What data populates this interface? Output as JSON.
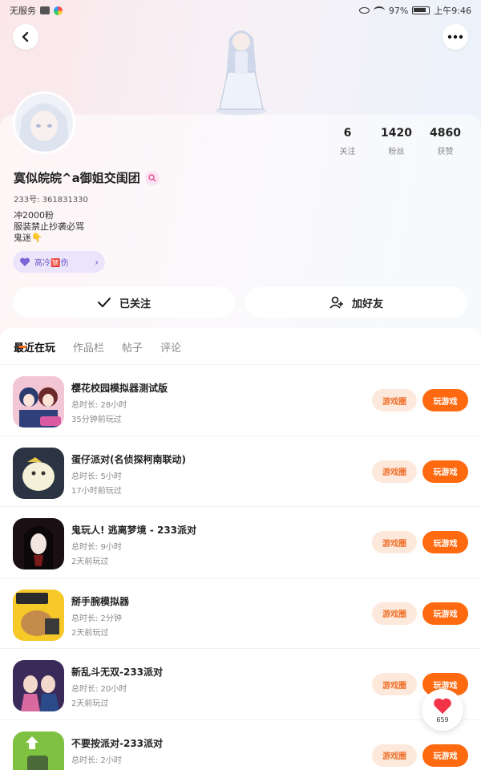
{
  "status_bar": {
    "left_text": "无服务",
    "battery": "97%",
    "time": "上午9:46"
  },
  "profile": {
    "name": "寞似皖皖^a御姐交闺团",
    "uid": "233号: 361831330",
    "bio": [
      "冲2000粉",
      "服装禁止抄袭必骂",
      "鬼迷👇"
    ],
    "tag_chip": "高冷🈲伤",
    "stats": [
      {
        "value": "6",
        "label": "关注"
      },
      {
        "value": "1420",
        "label": "粉丝"
      },
      {
        "value": "4860",
        "label": "获赞"
      }
    ],
    "follow_label": "已关注",
    "add_friend_label": "加好友"
  },
  "tabs": [
    {
      "label": "最近在玩",
      "active": true
    },
    {
      "label": "作品栏",
      "active": false
    },
    {
      "label": "帖子",
      "active": false
    },
    {
      "label": "评论",
      "active": false
    }
  ],
  "games": [
    {
      "title": "樱花校园模拟器测试版",
      "duration": "总时长: 28小时",
      "last_played": "35分钟前玩过",
      "circle_label": "游戏圈",
      "play_label": "玩游戏"
    },
    {
      "title": "蛋仔派对(名侦探柯南联动)",
      "duration": "总时长: 5小时",
      "last_played": "17小时前玩过",
      "circle_label": "游戏圈",
      "play_label": "玩游戏"
    },
    {
      "title": "鬼玩人! 逃离梦境 - 233派对",
      "duration": "总时长: 9小时",
      "last_played": "2天前玩过",
      "circle_label": "游戏圈",
      "play_label": "玩游戏"
    },
    {
      "title": "掰手腕模拟器",
      "duration": "总时长: 2分钟",
      "last_played": "2天前玩过",
      "circle_label": "游戏圈",
      "play_label": "玩游戏"
    },
    {
      "title": "新乱斗无双-233派对",
      "duration": "总时长: 20小时",
      "last_played": "2天前玩过",
      "circle_label": "游戏圈",
      "play_label": "玩游戏"
    },
    {
      "title": "不要按派对-233派对",
      "duration": "总时长: 2小时",
      "last_played": "",
      "circle_label": "游戏圈",
      "play_label": "玩游戏"
    }
  ],
  "like_button": {
    "count": "659"
  },
  "colors": {
    "accent": "#ff6a10",
    "accent_light": "#fde9dc",
    "tag_bg": "#ebe5fb"
  }
}
